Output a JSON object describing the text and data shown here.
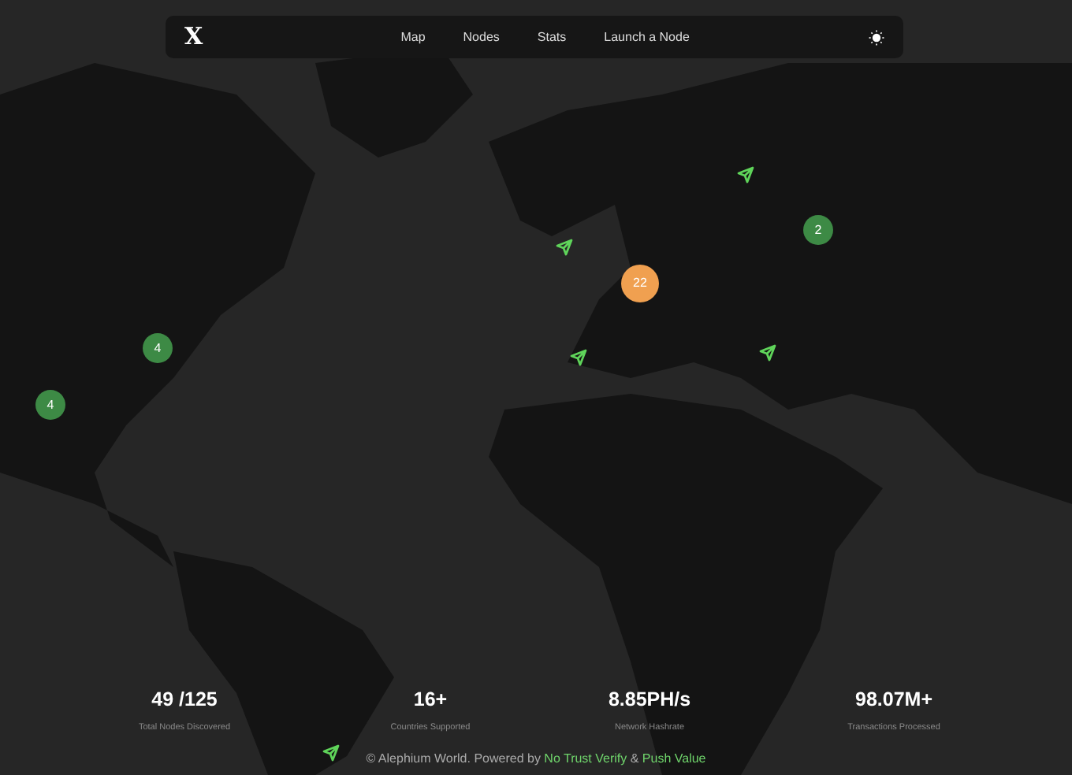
{
  "navbar": {
    "logo": "X",
    "links": [
      {
        "label": "Map"
      },
      {
        "label": "Nodes"
      },
      {
        "label": "Stats"
      },
      {
        "label": "Launch a Node"
      }
    ]
  },
  "map": {
    "markers": [
      {
        "kind": "cluster",
        "count": "22",
        "color": "#f0a050"
      },
      {
        "kind": "cluster",
        "count": "2",
        "color": "#3d8a45"
      },
      {
        "kind": "cluster",
        "count": "4",
        "color": "#3d8a45"
      },
      {
        "kind": "cluster",
        "count": "4",
        "color": "#3d8a45"
      },
      {
        "kind": "node"
      },
      {
        "kind": "node"
      },
      {
        "kind": "node"
      },
      {
        "kind": "node"
      },
      {
        "kind": "node"
      }
    ]
  },
  "stats": [
    {
      "value": "49 /125",
      "label": "Total Nodes Discovered"
    },
    {
      "value": "16+",
      "label": "Countries Supported"
    },
    {
      "value": "8.85PH/s",
      "label": "Network Hashrate"
    },
    {
      "value": "98.07M+",
      "label": "Transactions Processed"
    }
  ],
  "footer": {
    "text": "© Alephium World. Powered by",
    "link1": "No Trust Verify",
    "separator": "&",
    "link2": "Push Value"
  }
}
